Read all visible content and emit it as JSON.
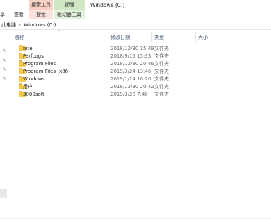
{
  "ribbon": {
    "context_search_label": "搜索工具",
    "context_manage_label": "管理",
    "window_title": "Windows (C:)",
    "tabs": [
      "享",
      "查看",
      "搜索",
      "驱动器工具"
    ]
  },
  "address": {
    "path": [
      "此电脑",
      "Windows (C:)"
    ],
    "separator": "›"
  },
  "columns": {
    "name": "名称",
    "date": "修改日期",
    "type": "类型",
    "size": "大小"
  },
  "rows": [
    {
      "name": "Intel",
      "date": "2018/12/30 15:49",
      "type": "文件夹"
    },
    {
      "name": "PerfLogs",
      "date": "2018/9/15 15:33",
      "type": "文件夹"
    },
    {
      "name": "Program Files",
      "date": "2018/12/30 20:46",
      "type": "文件夹"
    },
    {
      "name": "Program Files (x86)",
      "date": "2019/3/24 13:46",
      "type": "文件夹"
    },
    {
      "name": "Windows",
      "date": "2019/1/24 10:20",
      "type": "文件夹"
    },
    {
      "name": "用户",
      "date": "2018/12/30 20:42",
      "type": "文件夹"
    },
    {
      "name": "3000soft",
      "date": "2019/3/28 7:40",
      "type": "文件夹"
    }
  ],
  "icons": {
    "folder": "folder-icon",
    "pin": "pin-icon",
    "sort": "sort-up-icon"
  },
  "colors": {
    "context_search": "#f7cfc4",
    "context_manage": "#cfe8c3",
    "folder": "#f3c84c"
  }
}
